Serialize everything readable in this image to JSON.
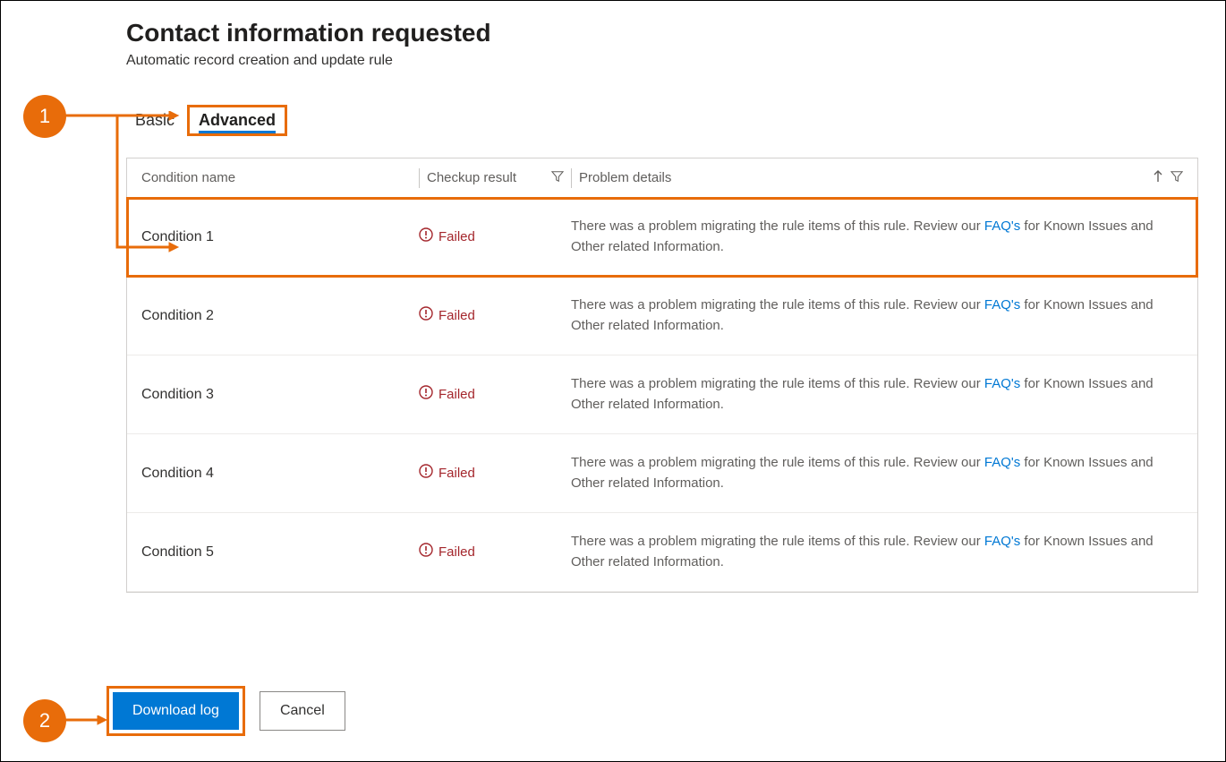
{
  "header": {
    "title": "Contact information requested",
    "subtitle": "Automatic record creation and update rule"
  },
  "tabs": {
    "basic": "Basic",
    "advanced": "Advanced"
  },
  "table": {
    "columns": {
      "condition_name": "Condition name",
      "checkup_result": "Checkup result",
      "problem_details": "Problem details"
    },
    "rows": [
      {
        "name": "Condition 1",
        "result": "Failed",
        "detail_pre": "There was a problem migrating the rule items of this rule. Review our ",
        "detail_link": "FAQ's",
        "detail_post": " for Known Issues and Other related Information."
      },
      {
        "name": "Condition 2",
        "result": "Failed",
        "detail_pre": "There was a problem migrating the rule items of this rule. Review our ",
        "detail_link": "FAQ's",
        "detail_post": " for Known Issues and Other related Information."
      },
      {
        "name": "Condition 3",
        "result": "Failed",
        "detail_pre": "There was a problem migrating the rule items of this rule. Review our ",
        "detail_link": "FAQ's",
        "detail_post": " for Known Issues and Other related Information."
      },
      {
        "name": "Condition 4",
        "result": "Failed",
        "detail_pre": "There was a problem migrating the rule items of this rule. Review our ",
        "detail_link": "FAQ's",
        "detail_post": " for Known Issues and Other related Information."
      },
      {
        "name": "Condition 5",
        "result": "Failed",
        "detail_pre": "There was a problem migrating the rule items of this rule. Review our ",
        "detail_link": "FAQ's",
        "detail_post": " for Known Issues and Other related Information."
      }
    ]
  },
  "buttons": {
    "download_log": "Download log",
    "cancel": "Cancel"
  },
  "annotations": {
    "c1": "1",
    "c2": "2"
  }
}
